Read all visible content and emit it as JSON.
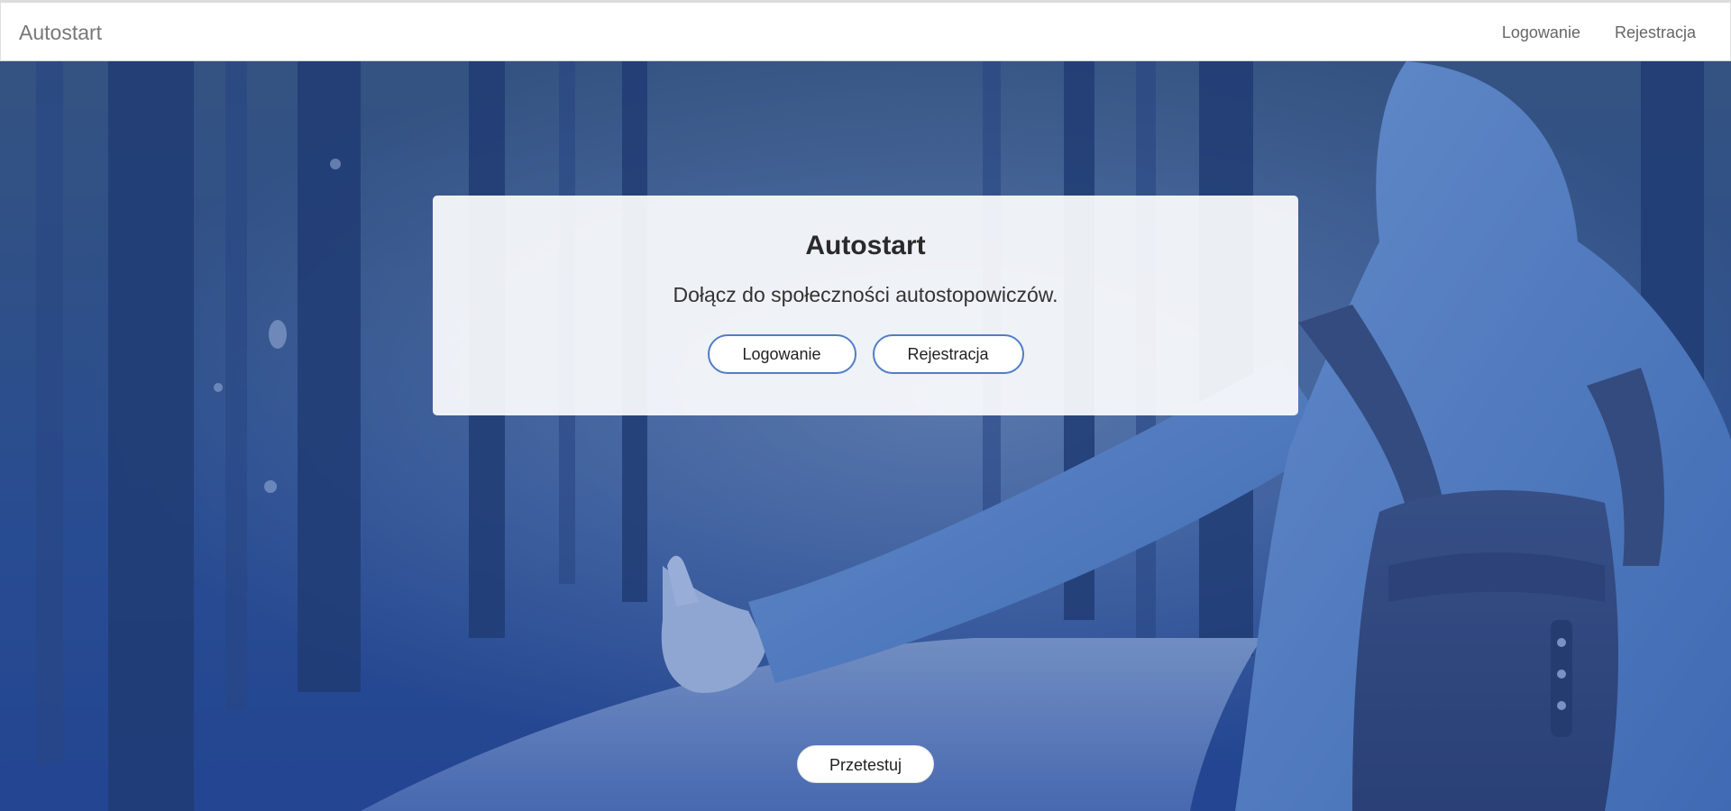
{
  "navbar": {
    "brand": "Autostart",
    "links": [
      {
        "label": "Logowanie"
      },
      {
        "label": "Rejestracja"
      }
    ]
  },
  "hero": {
    "title": "Autostart",
    "subtitle": "Dołącz do społeczności autostopowiczów.",
    "login_label": "Logowanie",
    "register_label": "Rejestracja",
    "try_label": "Przetestuj"
  },
  "colors": {
    "button_border": "#4f7ec6",
    "hero_tint": "#2850aa",
    "navbar_bg": "#ffffff"
  }
}
